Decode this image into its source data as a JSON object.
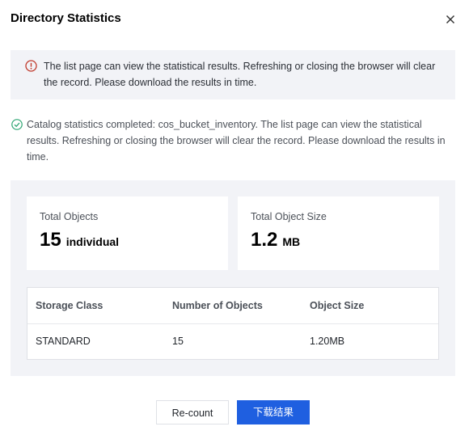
{
  "dialog": {
    "title": "Directory Statistics"
  },
  "alert": {
    "text": "The list page can view the statistical results. Refreshing or closing the browser will clear the record. Please download the results in time.",
    "color": "#c0392b"
  },
  "success": {
    "text": "Catalog statistics completed: cos_bucket_inventory. The list page can view the statistical results. Refreshing or closing the browser will clear the record. Please download the results in time.",
    "color": "#2ba471"
  },
  "summary": {
    "total_objects_label": "Total Objects",
    "total_objects_value": "15",
    "total_objects_unit": "individual",
    "total_size_label": "Total Object Size",
    "total_size_value": "1.2",
    "total_size_unit": "MB"
  },
  "table": {
    "headers": [
      "Storage Class",
      "Number of Objects",
      "Object Size"
    ],
    "rows": [
      [
        "STANDARD",
        "15",
        "1.20MB"
      ]
    ]
  },
  "buttons": {
    "recount": "Re-count",
    "download": "下载结果",
    "primary_color": "#1f5fe0"
  }
}
